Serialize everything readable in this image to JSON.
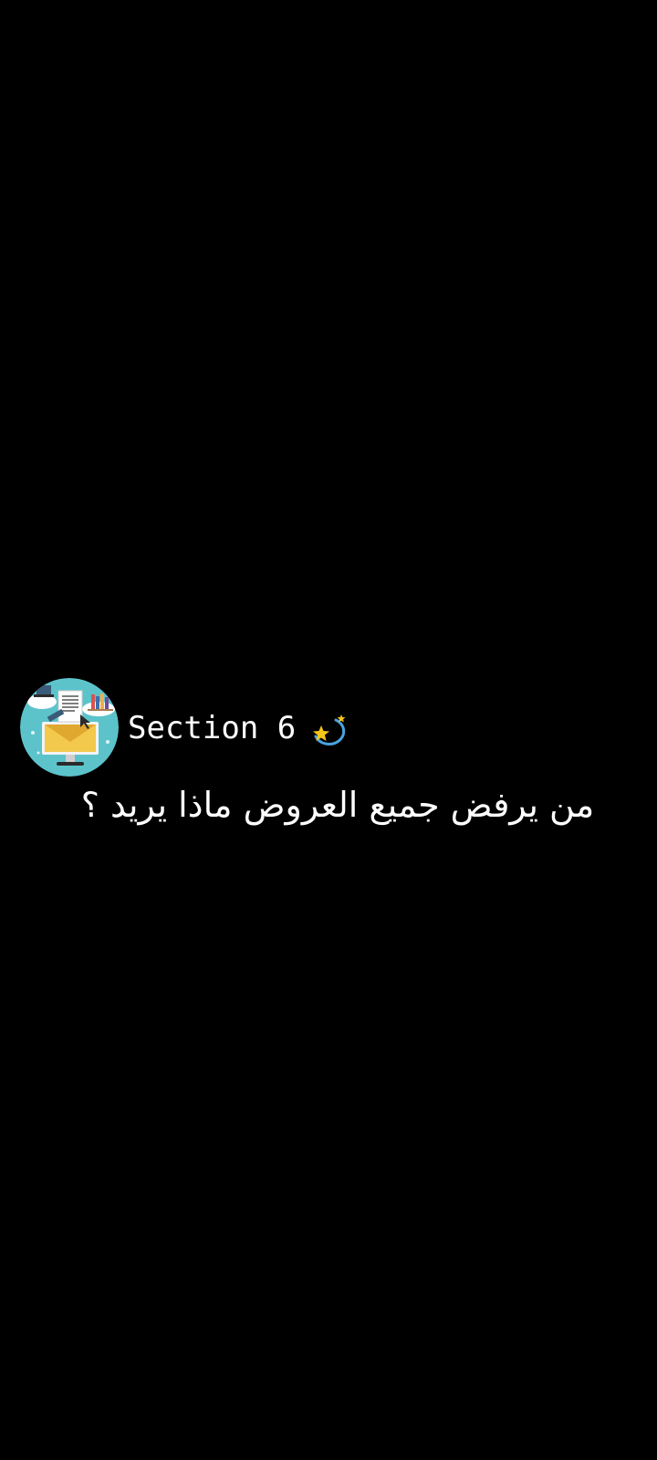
{
  "header": {
    "title": "Section 6"
  },
  "avatar": {
    "icon": "computer-monitor-icon",
    "background_color": "#5cc3cb"
  },
  "decoration": {
    "icon": "dizzy-star-icon"
  },
  "caption": {
    "text": "من يرفض جميع العروض ماذا يريد ؟"
  },
  "colors": {
    "background": "#000000",
    "text": "#ffffff"
  }
}
